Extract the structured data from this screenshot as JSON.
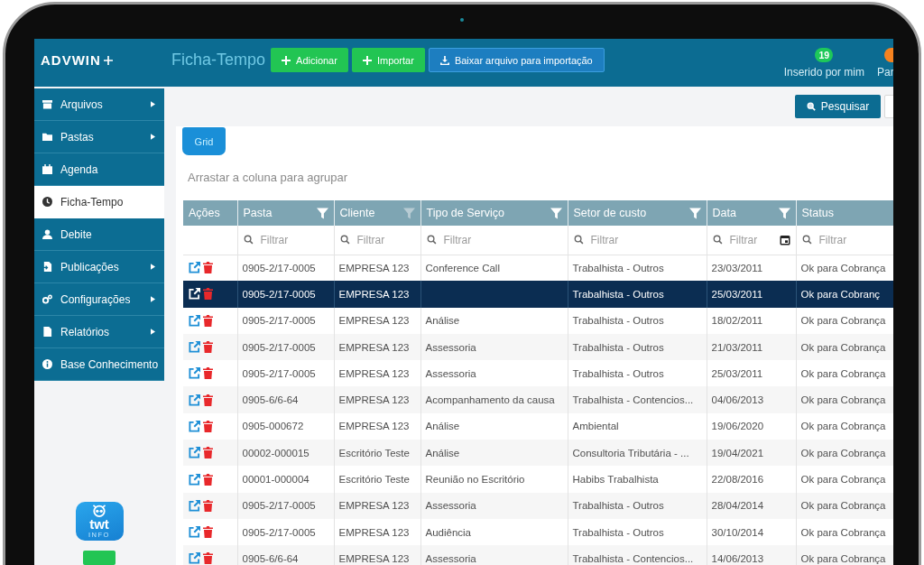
{
  "topbar": {
    "logo": "ADVWIN",
    "title": "Ficha-Tempo",
    "buttons": [
      {
        "label": "Adicionar",
        "kind": "add"
      },
      {
        "label": "Importar",
        "kind": "add"
      },
      {
        "label": "Baixar arquivo para importação",
        "kind": "download"
      }
    ],
    "counters": [
      {
        "count": "19",
        "label": "Inserido por mim",
        "color": "#1ec85a"
      },
      {
        "label": "Par",
        "color": "#f5821f"
      }
    ]
  },
  "sidebar": {
    "items": [
      {
        "label": "Arquivos",
        "submenu": true,
        "selected": false
      },
      {
        "label": "Pastas",
        "submenu": true,
        "selected": false
      },
      {
        "label": "Agenda",
        "submenu": false,
        "selected": false
      },
      {
        "label": "Ficha-Tempo",
        "submenu": false,
        "selected": true
      },
      {
        "label": "Debite",
        "submenu": false,
        "selected": false
      },
      {
        "label": "Publicações",
        "submenu": true,
        "selected": false
      },
      {
        "label": "Configurações",
        "submenu": true,
        "selected": false
      },
      {
        "label": "Relatórios",
        "submenu": true,
        "selected": false
      },
      {
        "label": "Base Conhecimento",
        "submenu": false,
        "selected": false
      }
    ],
    "brand": {
      "name": "twt",
      "tagline": "INFO"
    }
  },
  "toolbar": {
    "search_button": "Pesquisar"
  },
  "tabs": [
    {
      "label": "Grid",
      "selected": true
    }
  ],
  "group_hint": "Arrastar a coluna para agrupar",
  "table": {
    "actions_label": "Ações",
    "columns": [
      {
        "label": "Pasta",
        "filterable": true,
        "filter_active": true,
        "filter_placeholder": "Filtrar"
      },
      {
        "label": "Cliente",
        "filterable": true,
        "filter_active": false,
        "filter_placeholder": "Filtrar"
      },
      {
        "label": "Tipo de Serviço",
        "filterable": true,
        "filter_active": true,
        "filter_placeholder": "Filtrar"
      },
      {
        "label": "Setor de custo",
        "filterable": true,
        "filter_active": true,
        "filter_placeholder": "Filtrar"
      },
      {
        "label": "Data",
        "filterable": true,
        "filter_active": true,
        "filter_placeholder": "Filtrar",
        "date_picker": true
      },
      {
        "label": "Status",
        "filterable": false,
        "filter_placeholder": "Filtrar"
      }
    ],
    "rows": [
      {
        "selected": false,
        "cells": [
          "0905-2/17-0005",
          "EMPRESA 123",
          "Conference Call",
          "Trabalhista - Outros",
          "23/03/2011",
          "Ok para Cobrança"
        ]
      },
      {
        "selected": true,
        "cells": [
          "0905-2/17-0005",
          "EMPRESA 123",
          null,
          "Trabalhista - Outros",
          "25/03/2011",
          "Ok para Cobranç"
        ]
      },
      {
        "selected": false,
        "cells": [
          "0905-2/17-0005",
          "EMPRESA 123",
          "Análise",
          "Trabalhista - Outros",
          "18/02/2011",
          "Ok para Cobrança"
        ]
      },
      {
        "selected": false,
        "cells": [
          "0905-2/17-0005",
          "EMPRESA 123",
          "Assessoria",
          "Trabalhista - Outros",
          "21/03/2011",
          "Ok para Cobrança"
        ]
      },
      {
        "selected": false,
        "cells": [
          "0905-2/17-0005",
          "EMPRESA 123",
          "Assessoria",
          "Trabalhista - Outros",
          "25/03/2011",
          "Ok para Cobrança"
        ]
      },
      {
        "selected": false,
        "cells": [
          "0905-6/6-64",
          "EMPRESA 123",
          "Acompanhamento da causa",
          "Trabalhista - Contencios...",
          "04/06/2013",
          "Ok para Cobrança"
        ]
      },
      {
        "selected": false,
        "cells": [
          "0905-000672",
          "EMPRESA 123",
          "Análise",
          "Ambiental",
          "19/06/2020",
          "Ok para Cobrança"
        ]
      },
      {
        "selected": false,
        "cells": [
          "00002-000015",
          "Escritório Teste",
          "Análise",
          "Consultoria Tributária - ...",
          "19/04/2021",
          "Ok para Cobrança"
        ]
      },
      {
        "selected": false,
        "cells": [
          "00001-000004",
          "Escritório Teste",
          "Reunião no Escritório",
          "Habibs Trabalhista",
          "22/08/2016",
          "Ok para Cobrança"
        ]
      },
      {
        "selected": false,
        "cells": [
          "0905-2/17-0005",
          "EMPRESA 123",
          "Assessoria",
          "Trabalhista - Outros",
          "28/04/2014",
          "Ok para Cobrança"
        ]
      },
      {
        "selected": false,
        "cells": [
          "0905-2/17-0005",
          "EMPRESA 123",
          "Audiência",
          "Trabalhista - Outros",
          "30/10/2014",
          "Ok para Cobrança"
        ]
      },
      {
        "selected": false,
        "cells": [
          "0905-6/6-64",
          "EMPRESA 123",
          "Assessoria",
          "Trabalhista - Contencios...",
          "14/06/2013",
          "Ok para Cobrança"
        ]
      }
    ]
  }
}
